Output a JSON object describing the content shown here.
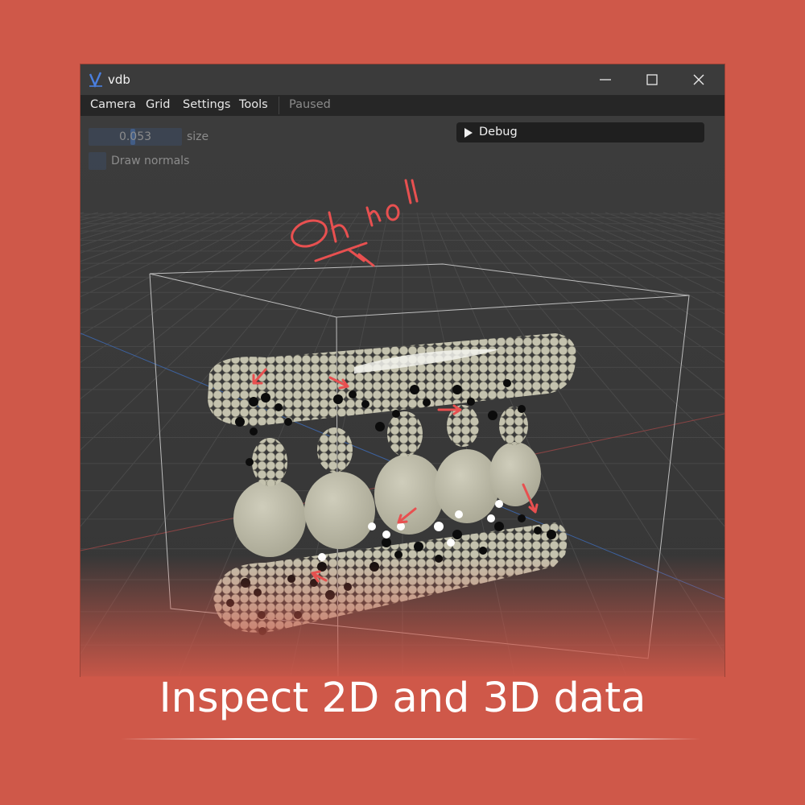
{
  "window": {
    "title": "vdb",
    "icons": {
      "logo": "vdb-logo-icon",
      "minimize": "minimize-icon",
      "maximize": "maximize-icon",
      "close": "close-icon"
    }
  },
  "menu": {
    "items": [
      {
        "label": "Camera"
      },
      {
        "label": "Grid"
      },
      {
        "label": "Settings"
      },
      {
        "label": "Tools"
      }
    ],
    "status": "Paused"
  },
  "controls": {
    "size": {
      "value": "0.053",
      "label": "size"
    },
    "draw_normals": {
      "label": "Draw normals",
      "checked": false
    }
  },
  "debug_panel": {
    "label": "Debug",
    "icon": "play-triangle-icon",
    "collapsed": true
  },
  "annotation": {
    "text": "Oh no!!",
    "color": "#e85050"
  },
  "caption": "Inspect 2D and 3D data",
  "colors": {
    "background": "#cf5849",
    "viewport": "#3a3a3a",
    "menubar": "#262626",
    "point_fill": "#c8c6b3",
    "annotation": "#e85050"
  }
}
